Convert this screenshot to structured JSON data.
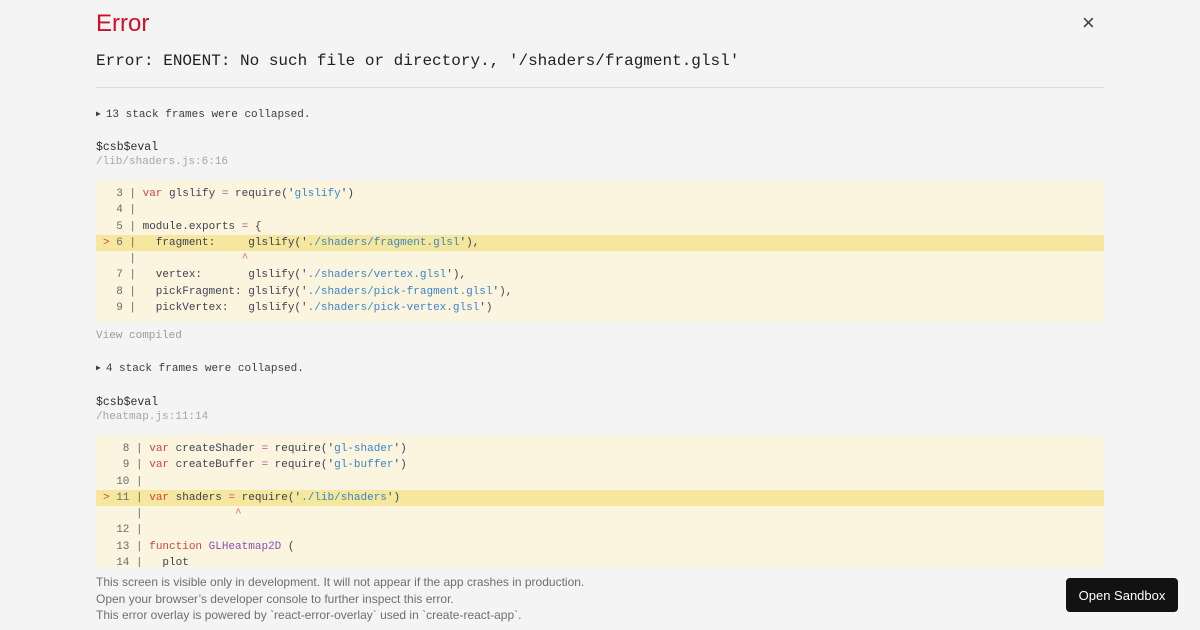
{
  "colors": {
    "page_bg": "#f4f4f4",
    "title_red": "#ce1126",
    "code_bg": "#fbf5df",
    "code_highlight": "#f5e79e",
    "keyword": "#d0454c",
    "operator": "#c04ea2",
    "string": "#3c85c7",
    "function_name": "#8a4dbf",
    "marker": "#e0413e",
    "button_bg": "#121212"
  },
  "header": {
    "title": "Error",
    "close_icon": "×"
  },
  "error_message": "Error: ENOENT: No such file or directory., '/shaders/fragment.glsl'",
  "icons": {
    "collapse_arrow": "▶"
  },
  "frames": [
    {
      "collapsed": "13 stack frames were collapsed.",
      "fn": "$csb$eval",
      "location": "/lib/shaders.js:6:16",
      "after_link": "View compiled",
      "code": {
        "lines": [
          [
            {
              "g": "  3 | "
            },
            {
              "k": "var"
            },
            {
              "d": " glslify "
            },
            {
              "o": "="
            },
            {
              "d": " require("
            },
            {
              "q": "'"
            },
            {
              "s": "glslify"
            },
            {
              "q": "'"
            },
            {
              "d": ")"
            }
          ],
          [
            {
              "g": "  4 | "
            }
          ],
          [
            {
              "g": "  5 | "
            },
            {
              "d": "module.exports "
            },
            {
              "o": "="
            },
            {
              "d": " {"
            }
          ],
          [
            {
              "m": ">"
            },
            {
              "g": " 6 | "
            },
            {
              "d": "  fragment:     glslify("
            },
            {
              "q": "'"
            },
            {
              "s": "./shaders/fragment.glsl"
            },
            {
              "q": "'"
            },
            {
              "d": "),"
            }
          ],
          [
            {
              "g": "    | "
            },
            {
              "c": "               ^"
            }
          ],
          [
            {
              "g": "  7 | "
            },
            {
              "d": "  vertex:       glslify("
            },
            {
              "q": "'"
            },
            {
              "s": "./shaders/vertex.glsl"
            },
            {
              "q": "'"
            },
            {
              "d": "),"
            }
          ],
          [
            {
              "g": "  8 | "
            },
            {
              "d": "  pickFragment: glslify("
            },
            {
              "q": "'"
            },
            {
              "s": "./shaders/pick-fragment.glsl"
            },
            {
              "q": "'"
            },
            {
              "d": "),"
            }
          ],
          [
            {
              "g": "  9 | "
            },
            {
              "d": "  pickVertex:   glslify("
            },
            {
              "q": "'"
            },
            {
              "s": "./shaders/pick-vertex.glsl"
            },
            {
              "q": "'"
            },
            {
              "d": ")"
            }
          ]
        ]
      }
    },
    {
      "collapsed": "4 stack frames were collapsed.",
      "fn": "$csb$eval",
      "location": "/heatmap.js:11:14",
      "code": {
        "lines": [
          [
            {
              "g": "   8 | "
            },
            {
              "k": "var"
            },
            {
              "d": " createShader "
            },
            {
              "o": "="
            },
            {
              "d": " require("
            },
            {
              "q": "'"
            },
            {
              "s": "gl-shader"
            },
            {
              "q": "'"
            },
            {
              "d": ")"
            }
          ],
          [
            {
              "g": "   9 | "
            },
            {
              "k": "var"
            },
            {
              "d": " createBuffer "
            },
            {
              "o": "="
            },
            {
              "d": " require("
            },
            {
              "q": "'"
            },
            {
              "s": "gl-buffer"
            },
            {
              "q": "'"
            },
            {
              "d": ")"
            }
          ],
          [
            {
              "g": "  10 | "
            }
          ],
          [
            {
              "m": ">"
            },
            {
              "g": " 11 | "
            },
            {
              "k": "var"
            },
            {
              "d": " shaders "
            },
            {
              "o": "="
            },
            {
              "d": " require("
            },
            {
              "q": "'"
            },
            {
              "s": "./lib/shaders"
            },
            {
              "q": "'"
            },
            {
              "d": ")"
            }
          ],
          [
            {
              "g": "     | "
            },
            {
              "c": "             ^"
            }
          ],
          [
            {
              "g": "  12 | "
            }
          ],
          [
            {
              "g": "  13 | "
            },
            {
              "k": "function"
            },
            {
              "d": " "
            },
            {
              "f": "GLHeatmap2D"
            },
            {
              "d": " ("
            }
          ],
          [
            {
              "g": "  14 | "
            },
            {
              "d": "  plot"
            }
          ]
        ]
      }
    }
  ],
  "footer": {
    "lines": [
      "This screen is visible only in development. It will not appear if the app crashes in production.",
      "Open your browser’s developer console to further inspect this error.",
      "This error overlay is powered by `react-error-overlay` used in `create-react-app`."
    ],
    "button_label": "Open Sandbox"
  }
}
